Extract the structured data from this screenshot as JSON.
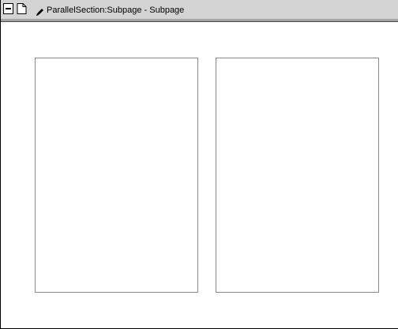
{
  "window": {
    "title": "ParallelSection:Subpage - Subpage"
  },
  "icons": {
    "collapse": "collapse-box-icon",
    "page": "page-document-icon",
    "section": "parallel-section-pencil-icon"
  },
  "panes": [
    {
      "name": "left-subpage-pane"
    },
    {
      "name": "right-subpage-pane"
    }
  ]
}
